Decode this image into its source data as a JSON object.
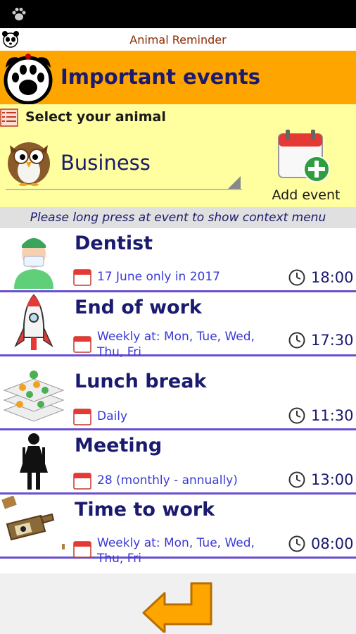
{
  "app": {
    "title": "Animal Reminder"
  },
  "header": {
    "title": "Important events"
  },
  "selector": {
    "label": "Select your animal",
    "selected_value": "Business",
    "selected_icon": "owl-icon"
  },
  "add_event": {
    "label": "Add event",
    "icon": "calendar-add-icon"
  },
  "hint": "Please long press at event to show context menu",
  "events": [
    {
      "title": "Dentist",
      "date": "17 June only in 2017",
      "time": "18:00",
      "icon": "dentist-icon"
    },
    {
      "title": "End of work",
      "date": "Weekly at: Mon, Tue, Wed, Thu, Fri",
      "time": "17:30",
      "icon": "rocket-icon"
    },
    {
      "title": "Lunch break",
      "date": "Daily",
      "time": "11:30",
      "icon": "food-icon"
    },
    {
      "title": "Meeting",
      "date": "28 (monthly - annually)",
      "time": "13:00",
      "icon": "woman-icon"
    },
    {
      "title": "Time to work",
      "date": "Weekly at: Mon, Tue, Wed, Thu, Fri",
      "time": "08:00",
      "icon": "bottle-icon"
    }
  ],
  "colors": {
    "header": "#ffa500",
    "selector_bg": "#ffffa0",
    "title_text": "#1a1a6e",
    "divider": "#6a4fcf",
    "date_text": "#3a3ad6"
  }
}
